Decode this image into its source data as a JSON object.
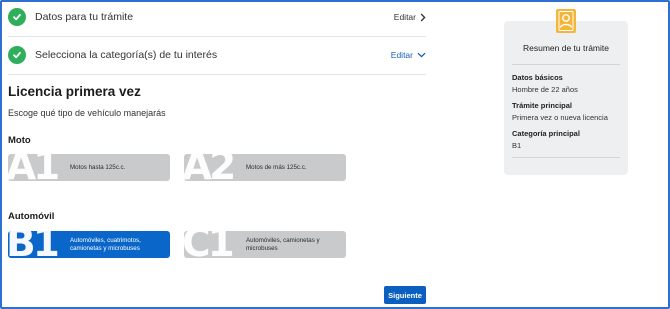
{
  "steps": [
    {
      "title": "Datos para tu trámite",
      "edit": "Editar"
    },
    {
      "title": "Selecciona la categoría(s) de tu interés",
      "edit": "Editar"
    }
  ],
  "main": {
    "title": "Licencia primera vez",
    "subtitle": "Escoge qué tipo de vehículo manejarás"
  },
  "categories": [
    {
      "name": "Moto",
      "options": [
        {
          "code": "A1",
          "desc": "Motos hasta 125c.c.",
          "selected": false
        },
        {
          "code": "A2",
          "desc": "Motos de más 125c.c.",
          "selected": false
        }
      ]
    },
    {
      "name": "Automóvil",
      "options": [
        {
          "code": "B1",
          "desc": "Automóviles, cuatrimotos, camionetas y microbuses",
          "selected": true
        },
        {
          "code": "C1",
          "desc": "Automóviles, camionetas y microbuses",
          "selected": false
        }
      ]
    }
  ],
  "next_button": "Siguiente",
  "summary": {
    "title": "Resumen de tu trámite",
    "fields": [
      {
        "label": "Datos básicos",
        "value": "Hombre de 22 años"
      },
      {
        "label": "Trámite principal",
        "value": "Primera vez o nueva licencia"
      },
      {
        "label": "Categoría principal",
        "value": "B1"
      }
    ]
  },
  "colors": {
    "accent": "#0a67c9",
    "check_green": "#2fae5c",
    "card_grey": "#c9cacc",
    "summary_icon": "#f4b63a",
    "frame_border": "#2f6fd0"
  },
  "icons": [
    "check-icon",
    "chevron-right-icon",
    "chevron-down-icon",
    "id-badge-icon"
  ]
}
